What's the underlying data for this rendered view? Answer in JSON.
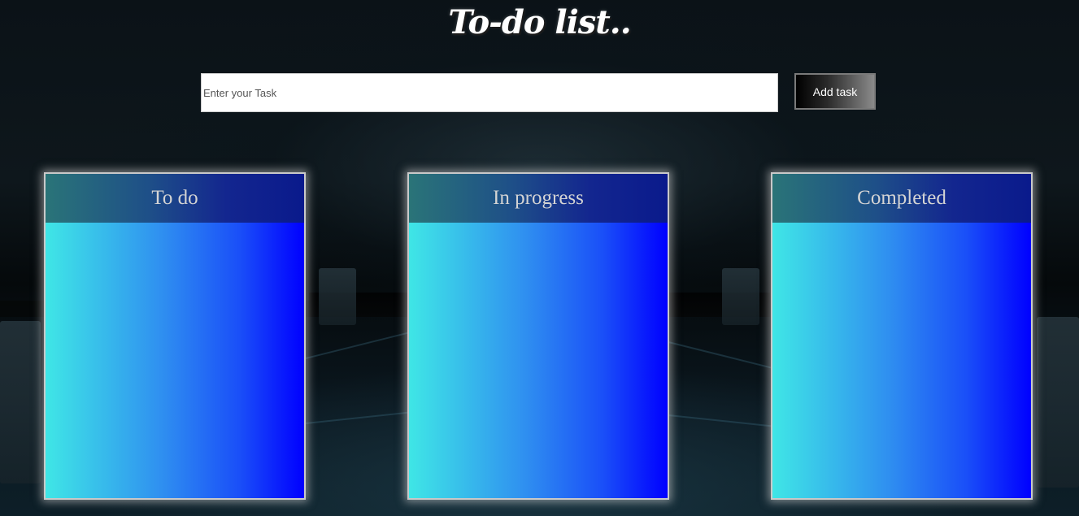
{
  "header": {
    "title": "To-do list.."
  },
  "task_form": {
    "input_value": "",
    "input_placeholder": "Enter your Task",
    "add_button_label": "Add task"
  },
  "columns": [
    {
      "title": "To do",
      "tasks": []
    },
    {
      "title": "In progress",
      "tasks": []
    },
    {
      "title": "Completed",
      "tasks": []
    }
  ],
  "colors": {
    "column_gradient_start": "#3fe6e6",
    "column_gradient_end": "#0000ff",
    "header_gradient_start": "#2a7478",
    "header_gradient_end": "#0a1a8c",
    "page_background": "#000000"
  }
}
